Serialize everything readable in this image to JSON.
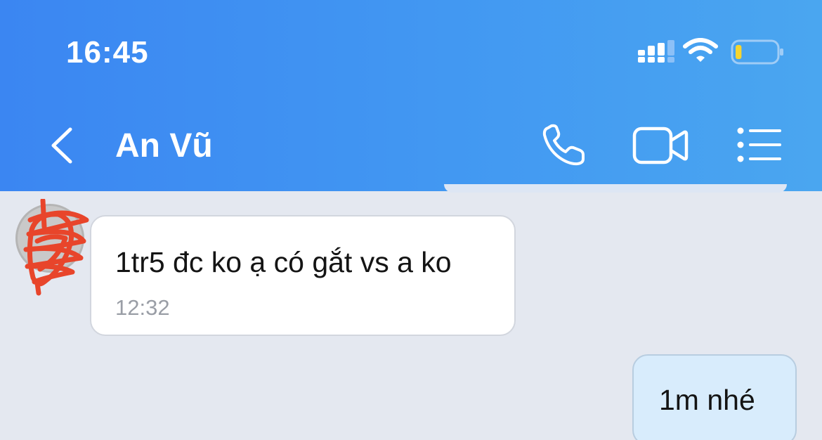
{
  "status_bar": {
    "time": "16:45",
    "icons": [
      "signal-icon",
      "wifi-icon",
      "battery-icon"
    ],
    "battery_level": 0.15
  },
  "header": {
    "back_icon": "chevron-left-icon",
    "title": "An Vũ",
    "actions": [
      "phone-icon",
      "video-camera-icon",
      "list-menu-icon"
    ],
    "background": "#3b86f2"
  },
  "messages": [
    {
      "direction": "incoming",
      "text": "1tr5 đc ko ạ có gắt vs a ko",
      "time": "12:32"
    },
    {
      "direction": "outgoing",
      "text": "1m nhé"
    }
  ],
  "colors": {
    "outgoing_bubble": "#d8ecfc",
    "incoming_bubble": "#ffffff",
    "chat_background": "#e4e8f0",
    "avatar_scribble": "#e8452b"
  }
}
